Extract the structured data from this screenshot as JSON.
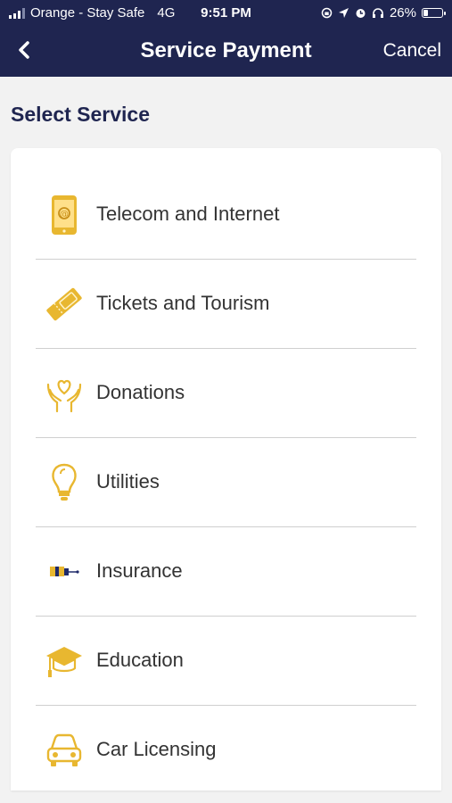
{
  "status_bar": {
    "carrier": "Orange - Stay Safe",
    "network": "4G",
    "time": "9:51 PM",
    "battery": "26%",
    "battery_level": 0.26
  },
  "nav": {
    "back_icon": "chevron-left-icon",
    "title": "Service Payment",
    "cancel_label": "Cancel"
  },
  "section_title": "Select Service",
  "colors": {
    "header": "#1f2550",
    "icon_gold": "#e8b730"
  },
  "services": [
    {
      "label": "Telecom and Internet",
      "icon": "phone-icon"
    },
    {
      "label": "Tickets and Tourism",
      "icon": "ticket-icon"
    },
    {
      "label": "Donations",
      "icon": "heart-hands-icon"
    },
    {
      "label": "Utilities",
      "icon": "lightbulb-icon"
    },
    {
      "label": "Insurance",
      "icon": "insurance-icon"
    },
    {
      "label": "Education",
      "icon": "graduation-cap-icon"
    },
    {
      "label": "Car Licensing",
      "icon": "car-icon"
    }
  ]
}
